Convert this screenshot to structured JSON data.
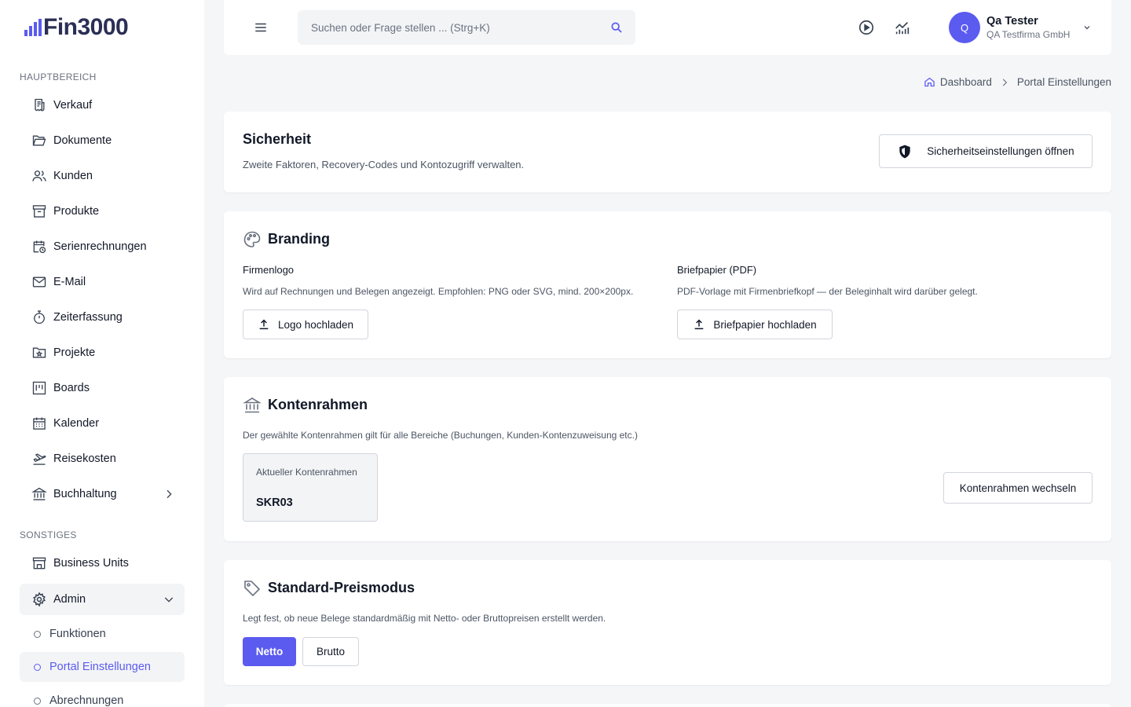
{
  "app": {
    "logo_text": "Fin3000"
  },
  "sidebar": {
    "section_main": "HAUPTBEREICH",
    "items": [
      {
        "label": "Verkauf",
        "icon": "receipt-icon"
      },
      {
        "label": "Dokumente",
        "icon": "folder-open-icon"
      },
      {
        "label": "Kunden",
        "icon": "users-icon"
      },
      {
        "label": "Produkte",
        "icon": "archive-box-icon"
      },
      {
        "label": "Serienrechnungen",
        "icon": "calendar-repeat-icon"
      },
      {
        "label": "E-Mail",
        "icon": "envelope-icon"
      },
      {
        "label": "Zeiterfassung",
        "icon": "stopwatch-icon"
      },
      {
        "label": "Projekte",
        "icon": "folder-star-icon"
      },
      {
        "label": "Boards",
        "icon": "kanban-board-icon"
      },
      {
        "label": "Kalender",
        "icon": "calendar-icon"
      },
      {
        "label": "Reisekosten",
        "icon": "plane-departure-icon"
      },
      {
        "label": "Buchhaltung",
        "icon": "bank-icon"
      }
    ],
    "section_other": "SONSTIGES",
    "other_items": [
      {
        "label": "Business Units",
        "icon": "storefront-icon"
      },
      {
        "label": "Admin",
        "icon": "gear-icon"
      }
    ],
    "admin_sub": [
      {
        "label": "Funktionen"
      },
      {
        "label": "Portal Einstellungen"
      },
      {
        "label": "Abrechnungen"
      }
    ]
  },
  "header": {
    "search_placeholder": "Suchen oder Frage stellen ... (Strg+K)",
    "user": {
      "initial": "Q",
      "name": "Qa Tester",
      "company": "QA Testfirma GmbH"
    }
  },
  "breadcrumb": {
    "home": "Dashboard",
    "current": "Portal Einstellungen"
  },
  "security": {
    "title": "Sicherheit",
    "desc": "Zweite Faktoren, Recovery-Codes und Kontozugriff verwalten.",
    "button": "Sicherheitseinstellungen öffnen"
  },
  "branding": {
    "title": "Branding",
    "logo": {
      "label": "Firmenlogo",
      "desc": "Wird auf Rechnungen und Belegen angezeigt. Empfohlen: PNG oder SVG, mind. 200×200px.",
      "button": "Logo hochladen"
    },
    "letterhead": {
      "label": "Briefpapier (PDF)",
      "desc": "PDF-Vorlage mit Firmenbriefkopf — der Beleginhalt wird darüber gelegt.",
      "button": "Briefpapier hochladen"
    }
  },
  "chart_of_accounts": {
    "title": "Kontenrahmen",
    "desc": "Der gewählte Kontenrahmen gilt für alle Bereiche (Buchungen, Kunden-Kontenzuweisung etc.)",
    "current_label": "Aktueller Kontenrahmen",
    "current_value": "SKR03",
    "button": "Kontenrahmen wechseln"
  },
  "price_mode": {
    "title": "Standard-Preismodus",
    "desc": "Legt fest, ob neue Belege standardmäßig mit Netto- oder Bruttopreisen erstellt werden.",
    "net": "Netto",
    "gross": "Brutto",
    "selected": "Netto"
  },
  "colors": {
    "accent": "#5b5bf0",
    "background": "#f5f6f8"
  }
}
